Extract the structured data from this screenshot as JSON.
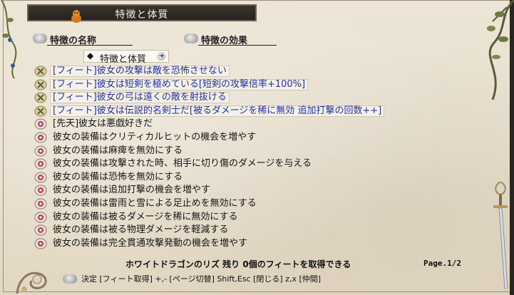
{
  "title": "特徴と体質",
  "columns": {
    "name_header": "特徴の名称",
    "effect_header": "特徴の効果"
  },
  "category": {
    "label": "特徴と体質",
    "marker": "◆"
  },
  "rows": [
    {
      "text": "[フィート]彼女の攻撃は敵を恐怖させない",
      "kind": "feat"
    },
    {
      "text": "[フィート]彼女は短剣を極めている[短剣の攻撃倍率+100%]",
      "kind": "feat"
    },
    {
      "text": "[フィート]彼女の弓は遠くの敵を射抜ける",
      "kind": "feat"
    },
    {
      "text": "[フィート]彼女は伝説的名剣士だ[被るダメージを稀に無効 追加打撃の回数++]",
      "kind": "feat"
    },
    {
      "text": "[先天]彼女は悪戯好きだ",
      "kind": "trait"
    },
    {
      "text": "彼女の装備はクリティカルヒットの機会を増やす",
      "kind": "trait"
    },
    {
      "text": "彼女の装備は麻痺を無効にする",
      "kind": "trait"
    },
    {
      "text": "彼女の装備は攻撃された時、相手に切り傷のダメージを与える",
      "kind": "trait"
    },
    {
      "text": "彼女の装備は恐怖を無効にする",
      "kind": "trait"
    },
    {
      "text": "彼女の装備は追加打撃の機会を増やす",
      "kind": "trait"
    },
    {
      "text": "彼女の装備は雷雨と雪による足止めを無効にする",
      "kind": "trait"
    },
    {
      "text": "彼女の装備は被るダメージを稀に無効にする",
      "kind": "trait"
    },
    {
      "text": "彼女の装備は被る物理ダメージを軽減する",
      "kind": "trait"
    },
    {
      "text": "彼女の装備は完全貫通攻撃発動の機会を増やす",
      "kind": "trait"
    }
  ],
  "footer": {
    "message": "ホワイトドラゴンのリズ 残り 0個のフィートを取得できる",
    "page": "Page.1/2",
    "help": "決定 [フィート取得]  +,- [ページ切替]  Shift,Esc [閉じる]  z,x [仲間]"
  },
  "colors": {
    "feat_text": "#2233aa",
    "trait_text": "#161616",
    "title_bg": "#26221e",
    "parchment": "#e8e0cf"
  }
}
